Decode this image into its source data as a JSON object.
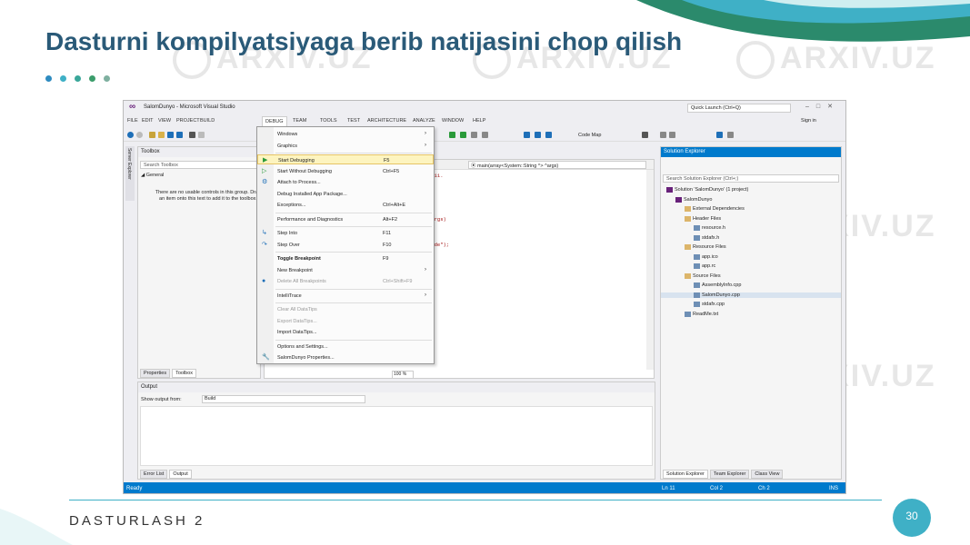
{
  "slide": {
    "title": "Dasturni kompilyatsiyaga berib natijasini chop qilish",
    "footer": "DASTURLASH 2",
    "page_number": "30",
    "dot_colors": [
      "#2e8bc0",
      "#3fb0c6",
      "#3aa79a",
      "#3b9d6b",
      "#7fb0a0"
    ],
    "accent_color": "#2a5a78"
  },
  "watermark": {
    "text": "ARXIV.UZ"
  },
  "vs": {
    "window_title": "SalomDunyo - Microsoft Visual Studio",
    "quick_launch_placeholder": "Quick Launch (Ctrl+Q)",
    "sign_in": "Sign in",
    "menu": [
      "FILE",
      "EDIT",
      "VIEW",
      "PROJECT",
      "BUILD",
      "DEBUG",
      "TEAM",
      "TOOLS",
      "TEST",
      "ARCHITECTURE",
      "ANALYZE",
      "WINDOW",
      "HELP"
    ],
    "toolbar_label": "Code Map",
    "server_explorer": "Server Explorer",
    "toolbox": {
      "title": "Toolbox",
      "search_placeholder": "Search Toolbox",
      "group": "◢ General",
      "message": "There are no usable controls in this group. Drag an item onto this text to add it to the toolbox.",
      "tabs": [
        "Properties",
        "Toolbox"
      ]
    },
    "editor": {
      "nav_right": "⦿ main(array<System::String ^> ^args)",
      "code_lines": [
        "1111.",
        "",
        "",
        "",
        "",
        "\"args)",
        "",
        "",
        "urde\");"
      ],
      "zoom": "100 %"
    },
    "debug_menu": {
      "items": [
        {
          "label": "Windows",
          "shortcut": "",
          "submenu": true,
          "icon": "",
          "state": ""
        },
        {
          "label": "Graphics",
          "shortcut": "",
          "submenu": true,
          "icon": "",
          "state": ""
        },
        {
          "label": "Start Debugging",
          "shortcut": "F5",
          "submenu": false,
          "icon": "▶",
          "state": "hl"
        },
        {
          "label": "Start Without Debugging",
          "shortcut": "Ctrl+F5",
          "submenu": false,
          "icon": "▷",
          "state": ""
        },
        {
          "label": "Attach to Process...",
          "shortcut": "",
          "submenu": false,
          "icon": "⚙",
          "state": ""
        },
        {
          "label": "Debug Installed App Package...",
          "shortcut": "",
          "submenu": false,
          "icon": "",
          "state": ""
        },
        {
          "label": "Exceptions...",
          "shortcut": "Ctrl+Alt+E",
          "submenu": false,
          "icon": "",
          "state": ""
        },
        {
          "label": "Performance and Diagnostics",
          "shortcut": "Alt+F2",
          "submenu": false,
          "icon": "",
          "state": ""
        },
        {
          "label": "Step Into",
          "shortcut": "F11",
          "submenu": false,
          "icon": "↳",
          "state": ""
        },
        {
          "label": "Step Over",
          "shortcut": "F10",
          "submenu": false,
          "icon": "↷",
          "state": ""
        },
        {
          "label": "Toggle Breakpoint",
          "shortcut": "F9",
          "submenu": false,
          "icon": "",
          "state": "bold"
        },
        {
          "label": "New Breakpoint",
          "shortcut": "",
          "submenu": true,
          "icon": "",
          "state": ""
        },
        {
          "label": "Delete All Breakpoints",
          "shortcut": "Ctrl+Shift+F9",
          "submenu": false,
          "icon": "●",
          "state": "dim"
        },
        {
          "label": "IntelliTrace",
          "shortcut": "",
          "submenu": true,
          "icon": "",
          "state": ""
        },
        {
          "label": "Clear All DataTips",
          "shortcut": "",
          "submenu": false,
          "icon": "",
          "state": "dim"
        },
        {
          "label": "Export DataTips...",
          "shortcut": "",
          "submenu": false,
          "icon": "",
          "state": "dim"
        },
        {
          "label": "Import DataTips...",
          "shortcut": "",
          "submenu": false,
          "icon": "",
          "state": ""
        },
        {
          "label": "Options and Settings...",
          "shortcut": "",
          "submenu": false,
          "icon": "",
          "state": ""
        },
        {
          "label": "SalomDunyo Properties...",
          "shortcut": "",
          "submenu": false,
          "icon": "🔧",
          "state": ""
        }
      ]
    },
    "output": {
      "title": "Output",
      "show_from_label": "Show output from:",
      "show_from_value": "Build",
      "tabs": [
        "Error List",
        "Output"
      ]
    },
    "solution_explorer": {
      "title": "Solution Explorer",
      "search_placeholder": "Search Solution Explorer (Ctrl+;)",
      "items": [
        {
          "label": "Solution 'SalomDunyo' (1 project)",
          "depth": 0,
          "selected": false
        },
        {
          "label": "SalomDunyo",
          "depth": 1,
          "selected": false
        },
        {
          "label": "External Dependencies",
          "depth": 2,
          "selected": false
        },
        {
          "label": "Header Files",
          "depth": 2,
          "selected": false
        },
        {
          "label": "resource.h",
          "depth": 3,
          "selected": false
        },
        {
          "label": "stdafx.h",
          "depth": 3,
          "selected": false
        },
        {
          "label": "Resource Files",
          "depth": 2,
          "selected": false
        },
        {
          "label": "app.ico",
          "depth": 3,
          "selected": false
        },
        {
          "label": "app.rc",
          "depth": 3,
          "selected": false
        },
        {
          "label": "Source Files",
          "depth": 2,
          "selected": false
        },
        {
          "label": "AssemblyInfo.cpp",
          "depth": 3,
          "selected": false
        },
        {
          "label": "SalomDunyo.cpp",
          "depth": 3,
          "selected": true
        },
        {
          "label": "stdafx.cpp",
          "depth": 3,
          "selected": false
        },
        {
          "label": "ReadMe.txt",
          "depth": 2,
          "selected": false
        }
      ],
      "tabs": [
        "Solution Explorer",
        "Team Explorer",
        "Class View"
      ]
    },
    "status": {
      "ready": "Ready",
      "ln": "Ln 11",
      "col": "Col 2",
      "ch": "Ch 2",
      "ins": "INS"
    }
  }
}
